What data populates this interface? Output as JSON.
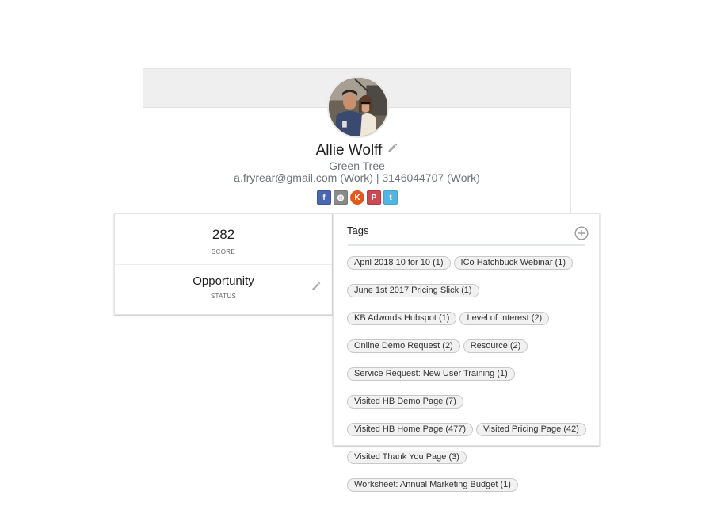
{
  "profile": {
    "name": "Allie Wolff",
    "company": "Green Tree",
    "contact_line": "a.fryrear@gmail.com (Work) | 3146044707 (Work)",
    "avatar_alt": "profile-photo",
    "socials": [
      {
        "name": "facebook",
        "glyph": "f"
      },
      {
        "name": "website",
        "glyph": "◍"
      },
      {
        "name": "klout",
        "glyph": "K"
      },
      {
        "name": "pinterest",
        "glyph": "P"
      },
      {
        "name": "twitter",
        "glyph": "t"
      }
    ]
  },
  "stats": {
    "score_value": "282",
    "score_label": "SCORE",
    "status_value": "Opportunity",
    "status_label": "STATUS"
  },
  "tags": {
    "title": "Tags",
    "rows": [
      [
        "April 2018 10 for 10 (1)",
        "ICo Hatchbuck Webinar (1)"
      ],
      [
        "June 1st 2017 Pricing Slick (1)"
      ],
      [
        "KB Adwords Hubspot (1)",
        "Level of Interest (2)"
      ],
      [
        "Online Demo Request (2)",
        "Resource (2)"
      ],
      [
        "Service Request: New User Training (1)"
      ],
      [
        "Visited HB Demo Page (7)"
      ],
      [
        "Visited HB Home Page (477)",
        "Visited Pricing Page (42)"
      ],
      [
        "Visited Thank You Page (3)"
      ],
      [
        "Worksheet: Annual Marketing Budget (1)"
      ]
    ]
  },
  "colors": {
    "header_bg": "#efefef",
    "facebook": "#4b67b0",
    "website": "#8a8a8a",
    "klout": "#e05a1c",
    "pinterest": "#cc4a56",
    "twitter": "#56b4e2"
  }
}
